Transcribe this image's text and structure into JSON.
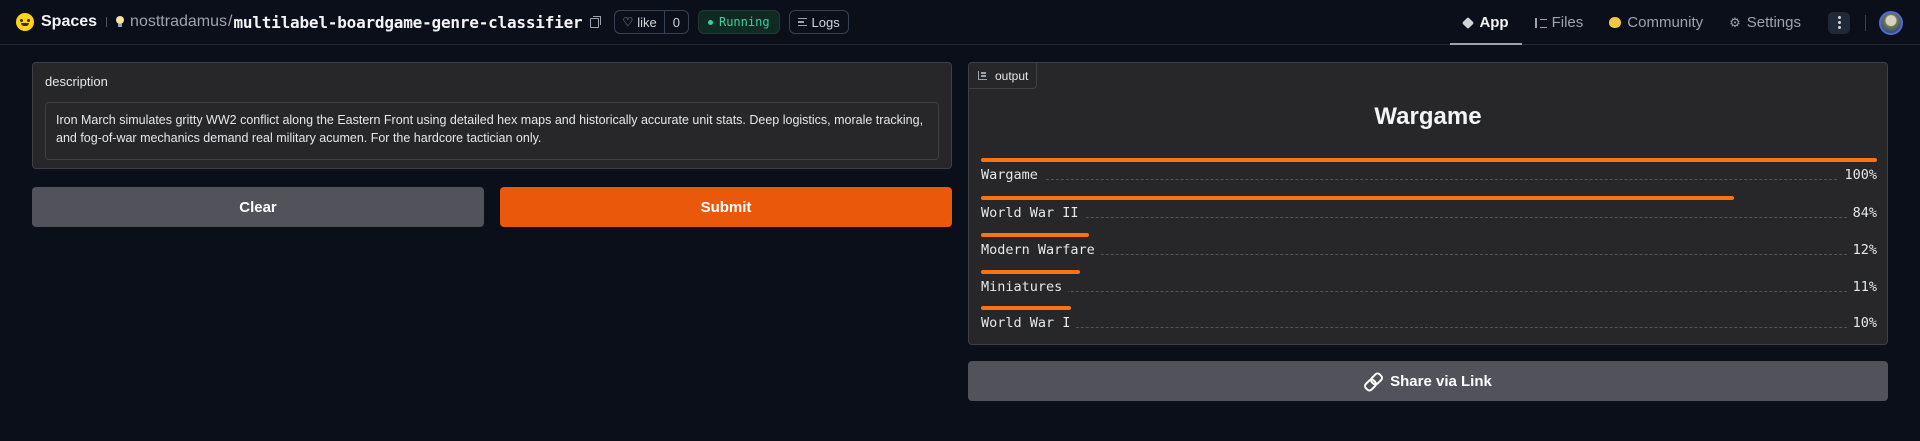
{
  "header": {
    "brand": "Spaces",
    "owner": "nosttradamus",
    "separator": "/",
    "repo": "multilabel-boardgame-genre-classifier",
    "like_label": "like",
    "like_count": "0",
    "status": "Running",
    "logs_label": "Logs",
    "tabs": [
      {
        "label": "App",
        "icon": "app-cube-icon",
        "active": true
      },
      {
        "label": "Files",
        "icon": "files-icon",
        "active": false
      },
      {
        "label": "Community",
        "icon": "community-icon",
        "active": false
      },
      {
        "label": "Settings",
        "icon": "gear-icon",
        "active": false
      }
    ]
  },
  "input": {
    "label": "description",
    "value": "Iron March simulates gritty WW2 conflict along the Eastern Front using detailed hex maps and historically accurate unit stats. Deep logistics, morale tracking, and fog-of-war mechanics demand real military acumen. For the hardcore tactician only.",
    "clear_label": "Clear",
    "submit_label": "Submit"
  },
  "output": {
    "tag": "output",
    "top_label": "Wargame",
    "labels": [
      {
        "name": "Wargame",
        "pct_text": "100%",
        "value": 1.0
      },
      {
        "name": "World War II",
        "pct_text": "84%",
        "value": 0.84
      },
      {
        "name": "Modern Warfare",
        "pct_text": "12%",
        "value": 0.12
      },
      {
        "name": "Miniatures",
        "pct_text": "11%",
        "value": 0.11
      },
      {
        "name": "World War I",
        "pct_text": "10%",
        "value": 0.1
      }
    ],
    "share_label": "Share via Link"
  },
  "colors": {
    "accent": "#ea580c",
    "bar": "#f97316",
    "running": "#34d399"
  }
}
